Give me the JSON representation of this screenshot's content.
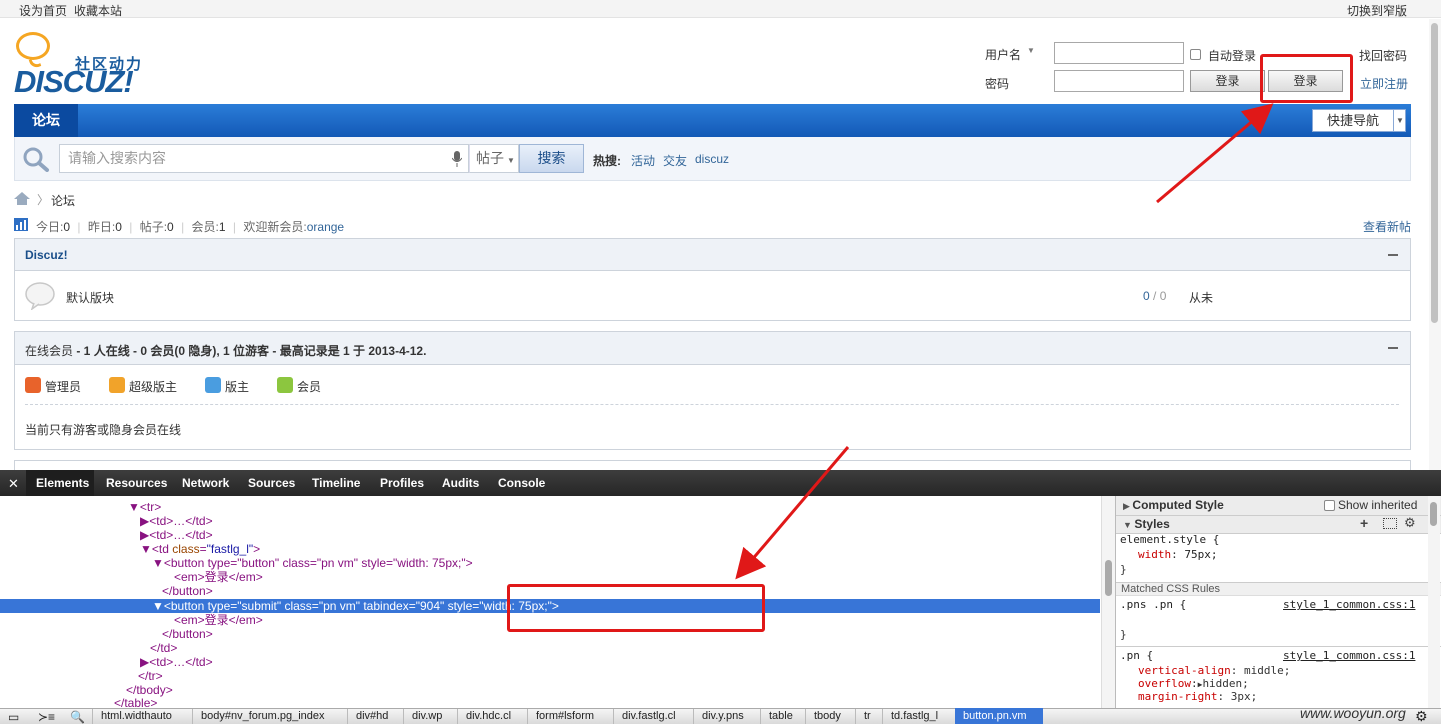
{
  "topbar": {
    "set_home": "设为首页",
    "bookmark": "收藏本站",
    "switch_width": "切换到窄版"
  },
  "logo": {
    "slogan": "社区动力",
    "text": "DISCUZ!"
  },
  "login": {
    "username_label": "用户名",
    "password_label": "密码",
    "auto_login": "自动登录",
    "login_btn_1": "登录",
    "login_btn_2": "登录",
    "forgot_password": "找回密码",
    "register": "立即注册"
  },
  "nav": {
    "forum_tab": "论坛",
    "quick_nav": "快捷导航"
  },
  "search": {
    "placeholder": "请输入搜索内容",
    "type": "帖子",
    "button": "搜索",
    "hot_label": "热搜:",
    "hot_items": [
      "活动",
      "交友",
      "discuz"
    ]
  },
  "breadcrumb": {
    "current": "论坛"
  },
  "stats": {
    "today_label": "今日:",
    "today": "0",
    "yesterday_label": "昨日:",
    "yesterday": "0",
    "posts_label": "帖子:",
    "posts": "0",
    "members_label": "会员:",
    "members": "1",
    "welcome_label": "欢迎新会员:",
    "new_member": "orange",
    "view_new": "查看新帖"
  },
  "forum_group": {
    "title": "Discuz!",
    "forum_name": "默认版块",
    "counts_a": "0",
    "counts_sep": "/",
    "counts_b": "0",
    "last_post": "从未"
  },
  "online": {
    "header_prefix": "在线会员",
    "header_rest": " - 1 人在线 - 0 会员(0 隐身), 1 位游客 - 最高记录是 1 于 2013-4-12.",
    "legend": [
      "管理员",
      "超级版主",
      "版主",
      "会员"
    ],
    "legend_colors": [
      "#e8632b",
      "#f1a32a",
      "#4a9de0",
      "#8cc63f"
    ],
    "empty": "当前只有游客或隐身会员在线"
  },
  "devtools": {
    "tabs": [
      "Elements",
      "Resources",
      "Network",
      "Sources",
      "Timeline",
      "Profiles",
      "Audits",
      "Console"
    ],
    "dom": {
      "l1": "▼<tr>",
      "l2": "▶<td>…</td>",
      "l3": "▶<td>…</td>",
      "l4_tag": "▼<td ",
      "l4_attr": "class",
      "l4_val": "\"fastlg_l\"",
      "l4_end": ">",
      "l5": "▼<button type=\"button\" class=\"pn vm\" style=\"width: 75px;\">",
      "l6": "<em>登录</em>",
      "l7": "</button>",
      "l8": "▼<button type=\"submit\" class=\"pn vm\" tabindex=\"904\" style=\"width: 75px;\">",
      "l9": "<em>登录</em>",
      "l10": "</button>",
      "l11": "</td>",
      "l12": "▶<td>…</td>",
      "l13": "</tr>",
      "l14": "</tbody>",
      "l15": "</table>"
    },
    "side": {
      "computed": "Computed Style",
      "show_inherited": "Show inherited",
      "styles": "Styles",
      "element_style": "element.style {",
      "width_prop": "width",
      "width_val": "75px;",
      "close_brace": "}",
      "matched": "Matched CSS Rules",
      "rule1_sel": ".pns .pn {",
      "rule1_src": "style_1_common.css:1",
      "rule2_sel": ".pn {",
      "rule2_src": "style_1_common.css:1",
      "va_prop": "vertical-align",
      "va_val": "middle;",
      "ov_prop": "overflow",
      "ov_val": "hidden;",
      "mr_prop": "margin-right",
      "mr_val": "3px;"
    },
    "crumbs": [
      "html.widthauto",
      "body#nv_forum.pg_index",
      "div#hd",
      "div.wp",
      "div.hdc.cl",
      "form#lsform",
      "div.fastlg.cl",
      "div.y.pns",
      "table",
      "tbody",
      "tr",
      "td.fastlg_l",
      "button.pn.vm"
    ]
  },
  "watermark": "www.wooyun.org",
  "accent_red": "#e01818"
}
